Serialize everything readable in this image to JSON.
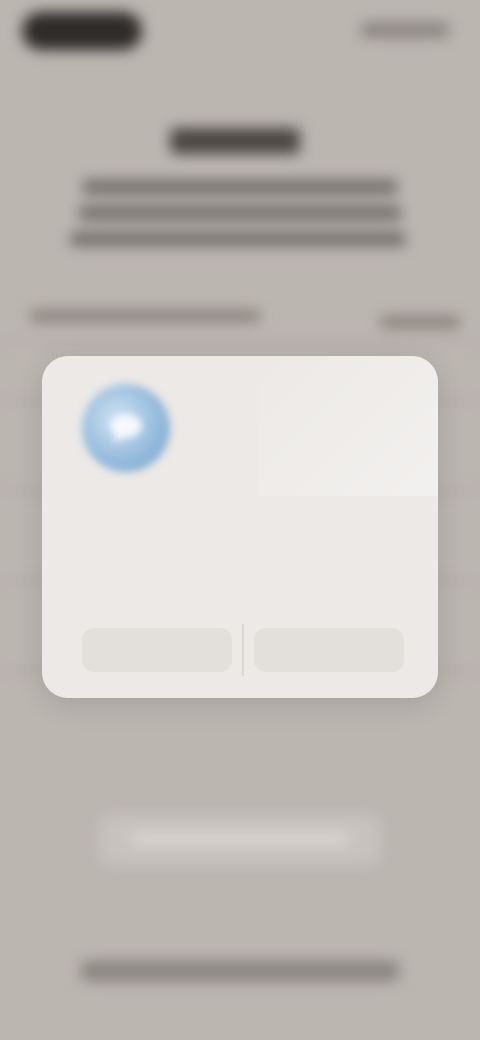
{
  "status_bar": {
    "time": "",
    "indicators": ""
  },
  "background": {
    "title": "",
    "subtitle": "",
    "setting_label": "",
    "setting_value": "",
    "primary_action": "",
    "footer_link": ""
  },
  "dialog": {
    "icon": "app-icon",
    "title": "",
    "message": "",
    "buttons": [
      {
        "label": ""
      },
      {
        "label": ""
      }
    ]
  },
  "colors": {
    "background": "#bcb6b1",
    "dialog": "#ece9e6",
    "icon_accent": "#6f9fcb"
  }
}
